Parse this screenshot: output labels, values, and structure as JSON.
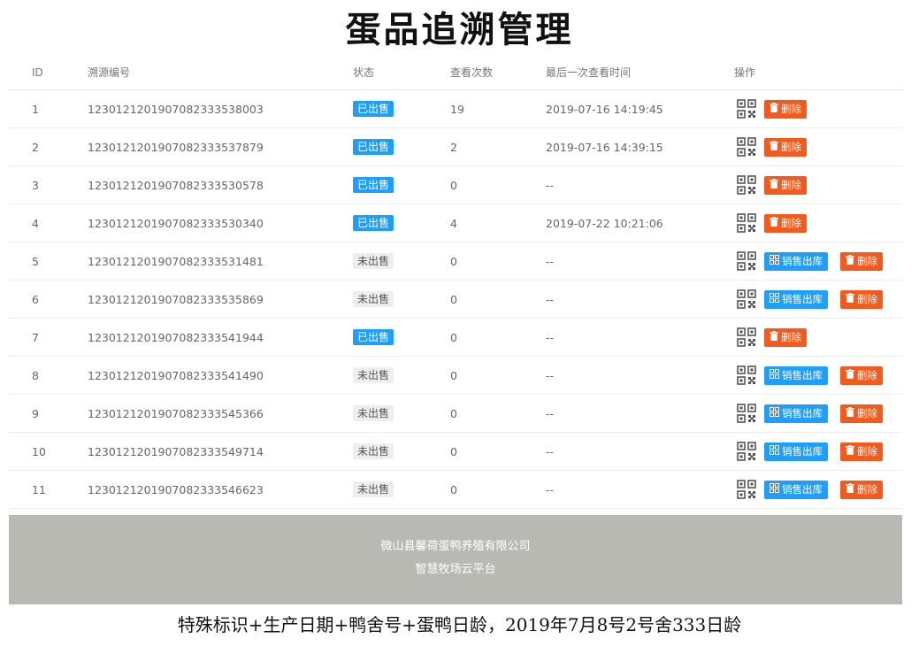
{
  "page": {
    "title": "蛋品追溯管理",
    "caption": "特殊标识+生产日期+鸭舍号+蛋鸭日龄，2019年7月8号2号舍333日龄"
  },
  "table": {
    "headers": {
      "id": "ID",
      "code": "溯源编号",
      "status": "状态",
      "views": "查看次数",
      "last_view": "最后一次查看时间",
      "ops": "操作"
    },
    "rows": [
      {
        "id": "1",
        "code": "1230121201907082333538003",
        "status": "已出售",
        "views": "19",
        "last_view": "2019-07-16 14:19:45"
      },
      {
        "id": "2",
        "code": "1230121201907082333537879",
        "status": "已出售",
        "views": "2",
        "last_view": "2019-07-16 14:39:15"
      },
      {
        "id": "3",
        "code": "1230121201907082333530578",
        "status": "已出售",
        "views": "0",
        "last_view": "--"
      },
      {
        "id": "4",
        "code": "1230121201907082333530340",
        "status": "已出售",
        "views": "4",
        "last_view": "2019-07-22 10:21:06"
      },
      {
        "id": "5",
        "code": "1230121201907082333531481",
        "status": "未出售",
        "views": "0",
        "last_view": "--"
      },
      {
        "id": "6",
        "code": "1230121201907082333535869",
        "status": "未出售",
        "views": "0",
        "last_view": "--"
      },
      {
        "id": "7",
        "code": "1230121201907082333541944",
        "status": "已出售",
        "views": "0",
        "last_view": "--"
      },
      {
        "id": "8",
        "code": "1230121201907082333541490",
        "status": "未出售",
        "views": "0",
        "last_view": "--"
      },
      {
        "id": "9",
        "code": "1230121201907082333545366",
        "status": "未出售",
        "views": "0",
        "last_view": "--"
      },
      {
        "id": "10",
        "code": "1230121201907082333549714",
        "status": "未出售",
        "views": "0",
        "last_view": "--"
      },
      {
        "id": "11",
        "code": "1230121201907082333546623",
        "status": "未出售",
        "views": "0",
        "last_view": "--"
      }
    ],
    "actions": {
      "delete_label": "删除",
      "ship_label": "销售出库"
    }
  },
  "footer": {
    "company": "微山县馨荷蛋鸭养殖有限公司",
    "platform": "智慧牧场云平台"
  },
  "colors": {
    "sold_badge": "#1e9fff",
    "unsold_badge": "#eeeeee",
    "delete_button": "#f25a1e",
    "ship_button": "#1e9fff",
    "footer_bg": "#b9b9b4"
  },
  "icons": {
    "qr": "qr-code-icon",
    "delete": "trash-icon",
    "ship": "grid-icon"
  }
}
